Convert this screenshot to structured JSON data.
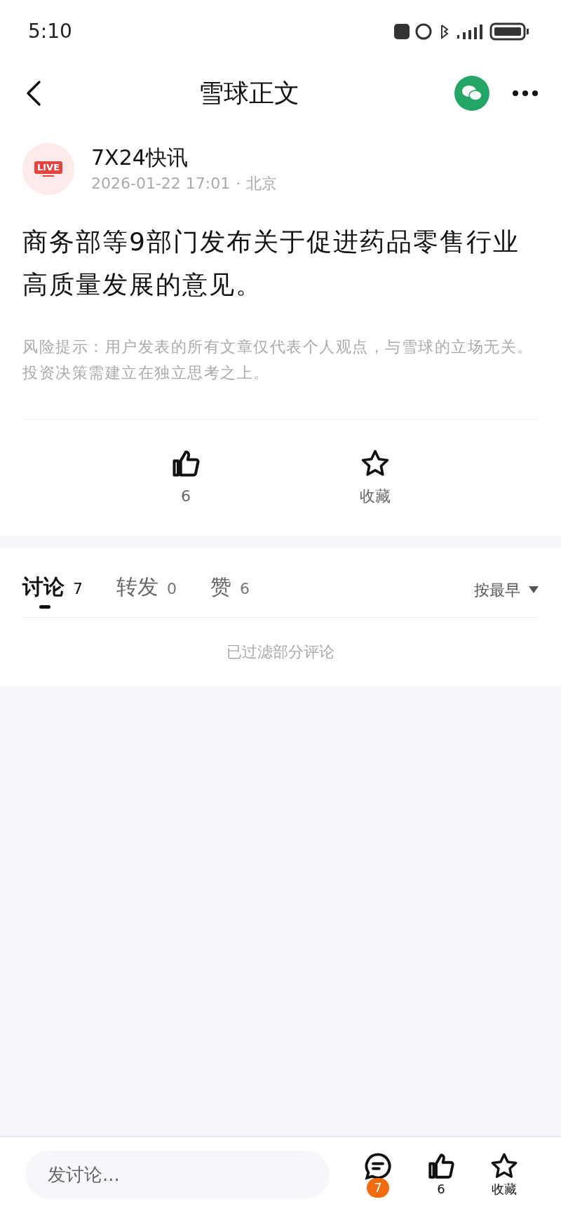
{
  "status_bar": {
    "time": "5:10"
  },
  "nav": {
    "title": "雪球正文"
  },
  "post": {
    "author": "7X24快讯",
    "avatar_badge": "LIVE",
    "time": "2026-01-22 17:01",
    "separator": "·",
    "location": "北京",
    "body": "商务部等9部门发布关于促进药品零售行业高质量发展的意见。",
    "risk_notice": "风险提示：用户发表的所有文章仅代表个人观点，与雪球的立场无关。投资决策需建立在独立思考之上。"
  },
  "actions": [
    {
      "kind": "like",
      "label": "6"
    },
    {
      "kind": "favorite",
      "label": "收藏"
    }
  ],
  "tabs": [
    {
      "label": "讨论",
      "count": "7",
      "selected": true
    },
    {
      "label": "转发",
      "count": "0",
      "selected": false
    },
    {
      "label": "赞",
      "count": "6",
      "selected": false
    }
  ],
  "sort": {
    "label": "按最早"
  },
  "filter_note": "已过滤部分评论",
  "bottom_bar": {
    "placeholder": "发讨论...",
    "items": [
      {
        "kind": "comment",
        "badge": "7"
      },
      {
        "kind": "like",
        "label": "6"
      },
      {
        "kind": "favorite",
        "label": "收藏"
      }
    ]
  }
}
